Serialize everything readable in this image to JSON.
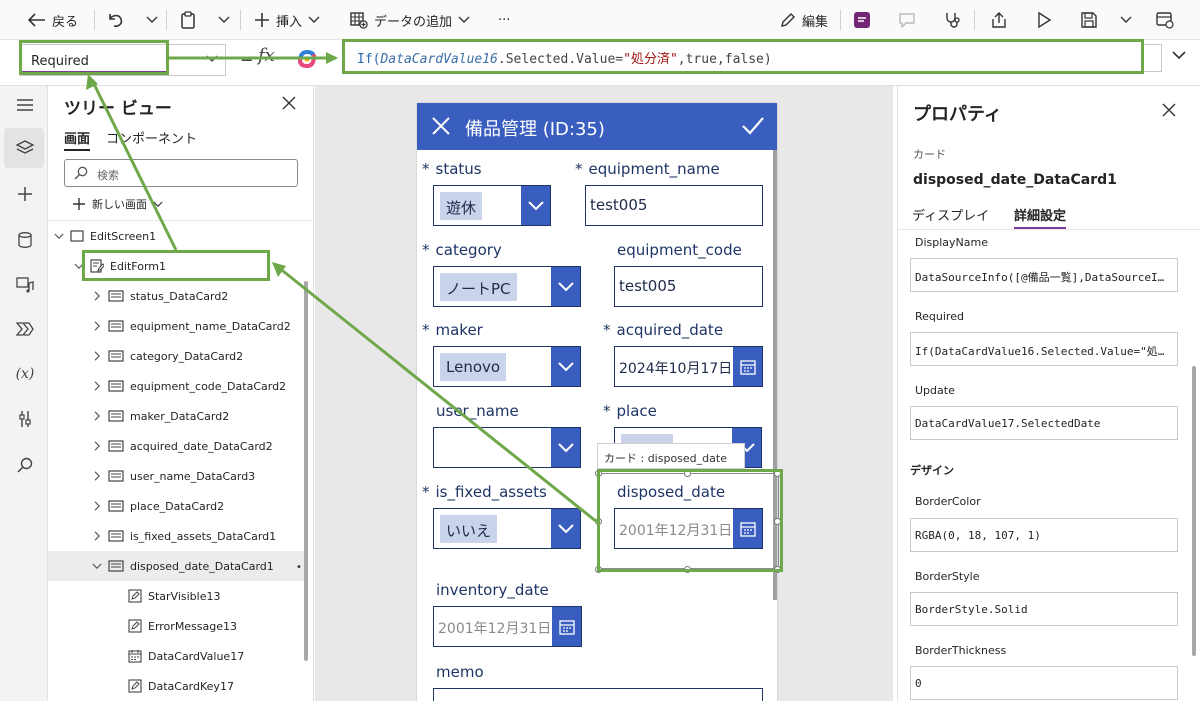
{
  "toolbar": {
    "back_label": "戻る",
    "insert_label": "挿入",
    "add_data_label": "データの追加",
    "more_label": "···",
    "edit_label": "編集"
  },
  "formula_bar": {
    "property": "Required",
    "equals": "=",
    "fx": "fx",
    "formula_parts": {
      "fn": "If(",
      "id": "DataCardValue16",
      "rest": ".Selected.Value=",
      "str": "\"処分済\"",
      "tail": ",true,false)"
    }
  },
  "tree": {
    "title": "ツリー ビュー",
    "tab_screens": "画面",
    "tab_components": "コンポーネント",
    "search_placeholder": "検索",
    "new_screen": "新しい画面",
    "nodes": [
      {
        "label": "EditScreen1"
      },
      {
        "label": "EditForm1"
      },
      {
        "label": "status_DataCard2"
      },
      {
        "label": "equipment_name_DataCard2"
      },
      {
        "label": "category_DataCard2"
      },
      {
        "label": "equipment_code_DataCard2"
      },
      {
        "label": "maker_DataCard2"
      },
      {
        "label": "acquired_date_DataCard2"
      },
      {
        "label": "user_name_DataCard3"
      },
      {
        "label": "place_DataCard2"
      },
      {
        "label": "is_fixed_assets_DataCard1"
      },
      {
        "label": "disposed_date_DataCard1"
      },
      {
        "label": "StarVisible13"
      },
      {
        "label": "ErrorMessage13"
      },
      {
        "label": "DataCardValue17"
      },
      {
        "label": "DataCardKey17"
      }
    ]
  },
  "form": {
    "title": "備品管理 (ID:35)",
    "star": "*",
    "status_label": "status",
    "status_value": "遊休",
    "equipment_name_label": "equipment_name",
    "equipment_name_value": "test005",
    "category_label": "category",
    "category_value": "ノートPC",
    "equipment_code_label": "equipment_code",
    "equipment_code_value": "test005",
    "maker_label": "maker",
    "maker_value": "Lenovo",
    "acquired_date_label": "acquired_date",
    "acquired_date_value": "2024年10月17日",
    "user_name_label": "user_name",
    "place_label": "place",
    "is_fixed_assets_label": "is_fixed_assets",
    "is_fixed_assets_value": "いいえ",
    "disposed_date_label": "disposed_date",
    "disposed_date_value": "2001年12月31日",
    "inventory_date_label": "inventory_date",
    "inventory_date_value": "2001年12月31日",
    "memo_label": "memo",
    "tooltip": "カード : disposed_date"
  },
  "props": {
    "title": "プロパティ",
    "type": "カード",
    "name": "disposed_date_DataCard1",
    "tab_display": "ディスプレイ",
    "tab_advanced": "詳細設定",
    "fields": [
      {
        "label": "DisplayName",
        "value": "DataSourceInfo([@備品一覧],DataSourceI…"
      },
      {
        "label": "Required",
        "value": "If(DataCardValue16.Selected.Value=\"処…"
      },
      {
        "label": "Update",
        "value": "DataCardValue17.SelectedDate"
      }
    ],
    "design_section": "デザイン",
    "design_fields": [
      {
        "label": "BorderColor",
        "value": "RGBA(0, 18, 107, 1)"
      },
      {
        "label": "BorderStyle",
        "value": "BorderStyle.Solid"
      },
      {
        "label": "BorderThickness",
        "value": "0"
      }
    ]
  },
  "colors": {
    "accent": "#3a5ec0",
    "annotation": "#6fa84a",
    "label_text": "#1e3566"
  }
}
